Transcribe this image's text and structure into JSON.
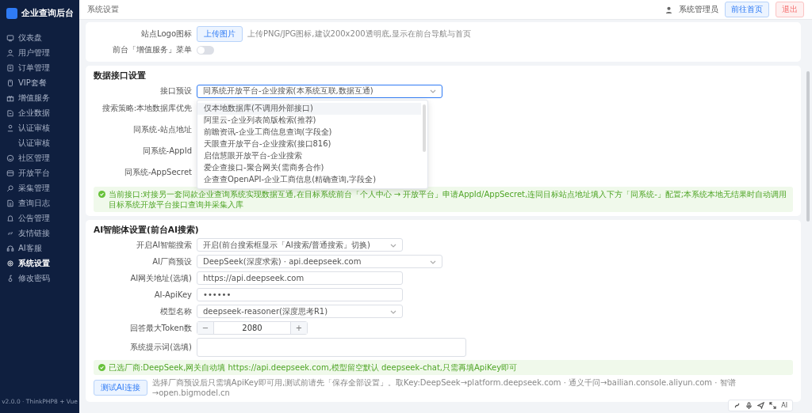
{
  "sidebar": {
    "brand": "企业查询后台",
    "items": [
      {
        "label": "仪表盘",
        "selected": false
      },
      {
        "label": "用户管理",
        "selected": false
      },
      {
        "label": "订单管理",
        "selected": false
      },
      {
        "label": "VIP套餐",
        "selected": false
      },
      {
        "label": "增值服务",
        "selected": false
      },
      {
        "label": "企业数据",
        "selected": false
      },
      {
        "label": "认证审核",
        "selected": false,
        "expanded": true,
        "children": [
          {
            "label": "认证审核",
            "selected": false
          }
        ]
      },
      {
        "label": "社区管理",
        "selected": false
      },
      {
        "label": "开放平台",
        "selected": false
      },
      {
        "label": "采集管理",
        "selected": false
      },
      {
        "label": "查询日志",
        "selected": false
      },
      {
        "label": "公告管理",
        "selected": false
      },
      {
        "label": "友情链接",
        "selected": false
      },
      {
        "label": "AI客服",
        "selected": false
      },
      {
        "label": "系统设置",
        "selected": true
      },
      {
        "label": "修改密码",
        "selected": false
      }
    ],
    "version": "v2.0.0 · ThinkPHP8 + Vue"
  },
  "header": {
    "breadcrumb": "系统设置",
    "user": "系统管理员",
    "home_button": "前往首页",
    "logout_button": "退出"
  },
  "site_card": {
    "logo_label": "站点Logo图标",
    "upload_button": "上传图片",
    "upload_hint": "上传PNG/JPG图标,建议200x200透明底,显示在前台导航与首页",
    "menu_label": "前台「增值服务」菜单",
    "menu_on": false
  },
  "data_interface": {
    "title": "数据接口设置",
    "preset": {
      "label": "接口预设",
      "value": "同系统开放平台-企业搜索(本系统互联,数据互通)",
      "expanded": true,
      "options": [
        {
          "label": "仅本地数据库(不调用外部接口)",
          "hovered": true
        },
        {
          "label": "阿里云-企业列表简版检索(推荐)",
          "hovered": false
        },
        {
          "label": "前瞻资讯-企业工商信息查询(字段全)",
          "hovered": false
        },
        {
          "label": "天眼查开放平台-企业搜索(接口816)",
          "hovered": false
        },
        {
          "label": "启信慧眼开放平台-企业搜索",
          "hovered": false
        },
        {
          "label": "爱企查接口-聚合网关(需商务合作)",
          "hovered": false
        },
        {
          "label": "企查查OpenAPI-企业工商信息(精确查询,字段全)",
          "hovered": false
        }
      ]
    },
    "rows": [
      "搜索策略:本地数据库优先",
      "同系统-站点地址",
      "同系统-AppId",
      "同系统-AppSecret"
    ],
    "notice": "当前接口:对接另一套同款企业查询系统实现数据互通,在目标系统前台「个人中心 → 开放平台」申请AppId/AppSecret,连同目标站点地址填入下方「同系统-」配置;本系统本地无结果时自动调用目标系统开放平台接口查询并采集入库"
  },
  "ai_settings": {
    "title": "AI智能体设置(前台AI搜索)",
    "fields": [
      {
        "kind": "select",
        "label": "开启AI智能搜索",
        "value": "开启(前台搜索框显示「AI搜索/普通搜索」切换)"
      },
      {
        "kind": "select-wide",
        "label": "AI厂商预设",
        "value": "DeepSeek(深度求索) · api.deepseek.com"
      },
      {
        "kind": "input",
        "label": "AI网关地址(选填)",
        "value": "https://api.deepseek.com"
      },
      {
        "kind": "input",
        "label": "AI-ApiKey",
        "value": "••••••"
      },
      {
        "kind": "select",
        "label": "模型名称",
        "value": "deepseek-reasoner(深度思考R1)"
      },
      {
        "kind": "stepper",
        "label": "回答最大Token数",
        "value": "2080",
        "minus": "−",
        "plus": "+"
      },
      {
        "kind": "textarea",
        "label": "系统提示词(选填)"
      }
    ],
    "notice": "已选厂商:DeepSeek,网关自动填 https://api.deepseek.com,模型留空默认 deepseek-chat,只需再填ApiKey即可",
    "test_button": "测试AI连接",
    "test_hint": "选择厂商预设后只需填ApiKey即可用,测试前请先「保存全部设置」。取Key:DeepSeek→platform.deepseek.com · 通义千问→bailian.console.aliyun.com · 智谱→open.bigmodel.cn"
  },
  "floating_toolbar": {
    "label": "AI"
  }
}
